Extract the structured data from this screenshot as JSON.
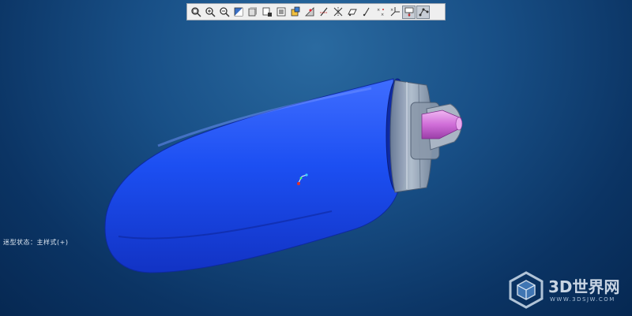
{
  "toolbar": {
    "buttons": [
      {
        "name": "refit-icon",
        "active": false
      },
      {
        "name": "zoom-in-icon",
        "active": false
      },
      {
        "name": "zoom-out-icon",
        "active": false
      },
      {
        "name": "repaint-icon",
        "active": false
      },
      {
        "name": "shading-style-icon",
        "active": false
      },
      {
        "name": "saved-views-icon",
        "active": false
      },
      {
        "name": "view-manager-icon",
        "active": false
      },
      {
        "name": "perspective-icon",
        "active": false
      },
      {
        "name": "spin-center-icon",
        "active": false
      },
      {
        "name": "datum-axes-icon",
        "active": false
      },
      {
        "name": "datum-planes-icon",
        "active": false
      },
      {
        "name": "datum-axis-display-icon",
        "active": false
      },
      {
        "name": "datum-points-icon",
        "active": false
      },
      {
        "name": "coordinate-systems-icon",
        "active": false
      },
      {
        "name": "annotations-icon",
        "active": true
      },
      {
        "name": "spin-center-display-icon",
        "active": true
      }
    ]
  },
  "status_text": "迷型状态：主样式(+)",
  "watermark": {
    "brand": "3D世界网",
    "url": "WWW.3DSJW.COM"
  },
  "colors": {
    "background_top": "#2a6aa0",
    "background_bottom": "#062852",
    "model_body": "#1f4ff0",
    "nozzle_tip": "#d27ad8",
    "cap_gray": "#9aa7b5"
  }
}
